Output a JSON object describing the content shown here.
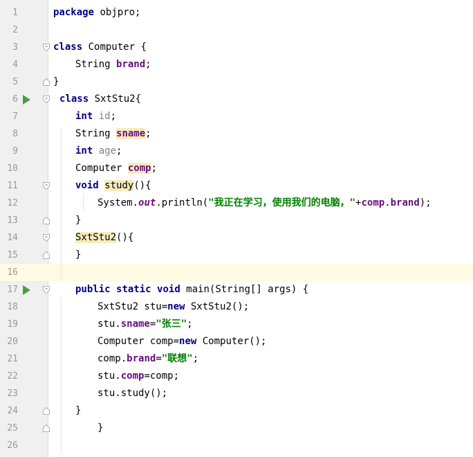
{
  "editor": {
    "current_line": 16,
    "lines": [
      {
        "n": "1",
        "t": [
          {
            "s": "package",
            "c": "kw"
          },
          {
            "s": " objpro;"
          }
        ]
      },
      {
        "n": "2",
        "t": []
      },
      {
        "n": "3",
        "t": [
          {
            "s": "class",
            "c": "kw"
          },
          {
            "s": " Computer {"
          }
        ],
        "fold": "open"
      },
      {
        "n": "4",
        "t": [
          {
            "s": "String "
          },
          {
            "s": "brand",
            "c": "field"
          },
          {
            "s": ";"
          }
        ]
      },
      {
        "n": "5",
        "t": [
          {
            "s": "}"
          }
        ],
        "fold": "close"
      },
      {
        "n": "6",
        "t": [
          {
            "s": "class",
            "c": "kw"
          },
          {
            "s": " SxtStu2{"
          }
        ],
        "fold": "open",
        "run": true
      },
      {
        "n": "7",
        "t": [
          {
            "s": "int",
            "c": "kw"
          },
          {
            "s": " "
          },
          {
            "s": "id",
            "c": "unused"
          },
          {
            "s": ";"
          }
        ]
      },
      {
        "n": "8",
        "t": [
          {
            "s": "String "
          },
          {
            "s": "sname",
            "c": "field hl"
          },
          {
            "s": ";"
          }
        ]
      },
      {
        "n": "9",
        "t": [
          {
            "s": "int",
            "c": "kw"
          },
          {
            "s": " "
          },
          {
            "s": "age",
            "c": "unused"
          },
          {
            "s": ";"
          }
        ]
      },
      {
        "n": "10",
        "t": [
          {
            "s": "Computer "
          },
          {
            "s": "comp",
            "c": "field hl"
          },
          {
            "s": ";"
          }
        ]
      },
      {
        "n": "11",
        "t": [
          {
            "s": "void",
            "c": "kw"
          },
          {
            "s": " "
          },
          {
            "s": "study",
            "c": "hl"
          },
          {
            "s": "(){"
          }
        ],
        "fold": "open"
      },
      {
        "n": "12",
        "t": [
          {
            "s": "System."
          },
          {
            "s": "out",
            "c": "sfield"
          },
          {
            "s": ".println("
          },
          {
            "s": "\"我正在学习，使用我们的电脑，\"",
            "c": "str"
          },
          {
            "s": "+"
          },
          {
            "s": "comp",
            "c": "field"
          },
          {
            "s": "."
          },
          {
            "s": "brand",
            "c": "field"
          },
          {
            "s": ");"
          }
        ]
      },
      {
        "n": "13",
        "t": [
          {
            "s": "}"
          }
        ],
        "fold": "close"
      },
      {
        "n": "14",
        "t": [
          {
            "s": "SxtStu2",
            "c": "hl"
          },
          {
            "s": "(){"
          }
        ],
        "fold": "open"
      },
      {
        "n": "15",
        "t": [
          {
            "s": "}"
          }
        ],
        "fold": "close"
      },
      {
        "n": "16",
        "t": []
      },
      {
        "n": "17",
        "t": [
          {
            "s": "public",
            "c": "kw"
          },
          {
            "s": " "
          },
          {
            "s": "static",
            "c": "kw"
          },
          {
            "s": " "
          },
          {
            "s": "void",
            "c": "kw"
          },
          {
            "s": " main(String[] args) {"
          }
        ],
        "fold": "open",
        "run": true
      },
      {
        "n": "18",
        "t": [
          {
            "s": "SxtStu2 stu="
          },
          {
            "s": "new",
            "c": "kw"
          },
          {
            "s": " SxtStu2();"
          }
        ]
      },
      {
        "n": "19",
        "t": [
          {
            "s": "stu."
          },
          {
            "s": "sname",
            "c": "field"
          },
          {
            "s": "="
          },
          {
            "s": "\"张三\"",
            "c": "str"
          },
          {
            "s": ";"
          }
        ]
      },
      {
        "n": "20",
        "t": [
          {
            "s": "Computer comp="
          },
          {
            "s": "new",
            "c": "kw"
          },
          {
            "s": " Computer();"
          }
        ]
      },
      {
        "n": "21",
        "t": [
          {
            "s": "comp."
          },
          {
            "s": "brand",
            "c": "field"
          },
          {
            "s": "="
          },
          {
            "s": "\"联想\"",
            "c": "str"
          },
          {
            "s": ";"
          }
        ]
      },
      {
        "n": "22",
        "t": [
          {
            "s": "stu."
          },
          {
            "s": "comp",
            "c": "field"
          },
          {
            "s": "=comp;"
          }
        ]
      },
      {
        "n": "23",
        "t": [
          {
            "s": "stu.study();"
          }
        ]
      },
      {
        "n": "24",
        "t": [
          {
            "s": "}"
          }
        ],
        "fold": "close"
      },
      {
        "n": "25",
        "t": [
          {
            "s": "}"
          }
        ],
        "fold": "close"
      },
      {
        "n": "26",
        "t": []
      }
    ]
  }
}
